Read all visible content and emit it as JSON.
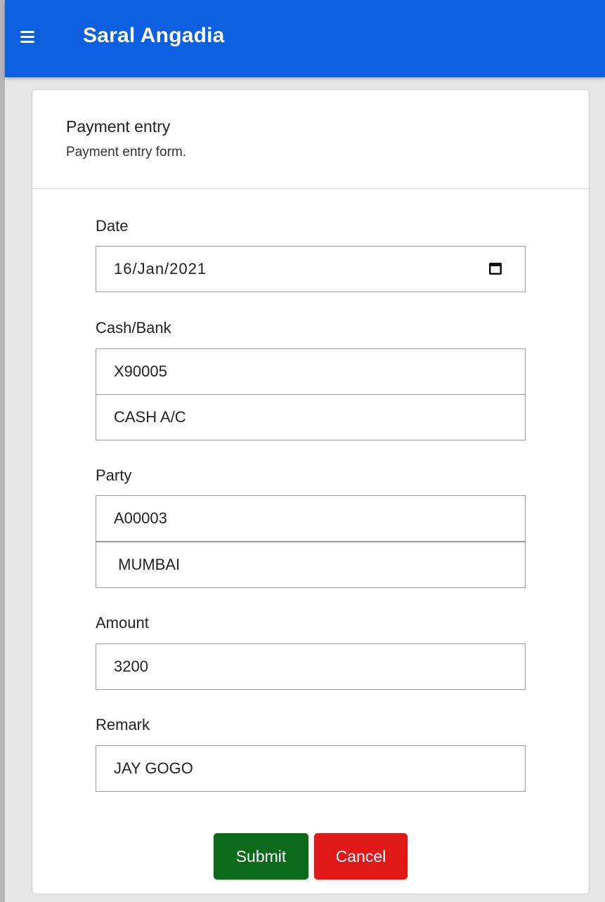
{
  "app": {
    "title": "Saral Angadia"
  },
  "card": {
    "title": "Payment entry",
    "subtitle": "Payment entry form."
  },
  "form": {
    "date_label": "Date",
    "date_value": "16/Jan/2021",
    "cashbank_label": "Cash/Bank",
    "cashbank_code": "X90005",
    "cashbank_name": "CASH A/C",
    "party_label": "Party",
    "party_code": "A00003",
    "party_name": " MUMBAI",
    "amount_label": "Amount",
    "amount_value": "3200",
    "remark_label": "Remark",
    "remark_value": "JAY GOGO"
  },
  "buttons": {
    "submit": "Submit",
    "cancel": "Cancel"
  },
  "colors": {
    "topbar": "#0b5fe0",
    "title": "#ffffff",
    "submit": "#0b6b1a",
    "cancel": "#e01818"
  },
  "icons": {
    "menu": "hamburger-menu-icon",
    "calendar": "calendar-icon"
  }
}
